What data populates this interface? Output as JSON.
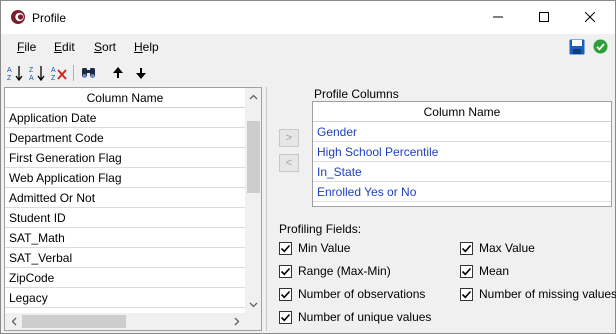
{
  "window": {
    "title": "Profile"
  },
  "menu": {
    "items": [
      {
        "key": "F",
        "rest": "ile"
      },
      {
        "key": "E",
        "rest": "dit"
      },
      {
        "key": "S",
        "rest": "ort"
      },
      {
        "key": "H",
        "rest": "elp"
      }
    ]
  },
  "toolbar": {
    "icons": [
      "sort-ascending-icon",
      "sort-descending-icon",
      "clear-sort-icon",
      "find-icon",
      "move-up-icon",
      "move-down-icon"
    ]
  },
  "columns_list": {
    "header": "Column Name",
    "rows": [
      "Application Date",
      "Department Code",
      "First Generation Flag",
      "Web Application Flag",
      "Admitted Or Not",
      "Student ID",
      "SAT_Math",
      "SAT_Verbal",
      "ZipCode",
      "Legacy"
    ]
  },
  "move_buttons": {
    "add": ">",
    "remove": "<"
  },
  "profile_columns": {
    "label": "Profile Columns",
    "header": "Column Name",
    "rows": [
      "Gender",
      "High School Percentile",
      "In_State",
      "Enrolled Yes or No"
    ]
  },
  "profiling_fields": {
    "label": "Profiling Fields:",
    "options": [
      {
        "label": "Min Value",
        "checked": true
      },
      {
        "label": "Max Value",
        "checked": true
      },
      {
        "label": "Range (Max-Min)",
        "checked": true
      },
      {
        "label": "Mean",
        "checked": true
      },
      {
        "label": "Number of observations",
        "checked": true
      },
      {
        "label": "Number of missing values",
        "checked": true
      },
      {
        "label": "Number of unique values",
        "checked": true
      }
    ]
  },
  "colors": {
    "accent_text": "#1f3fbf",
    "save_icon": "#1c5fb8",
    "ok_icon": "#2e9e3a",
    "app_icon": "#7a1c2e"
  }
}
